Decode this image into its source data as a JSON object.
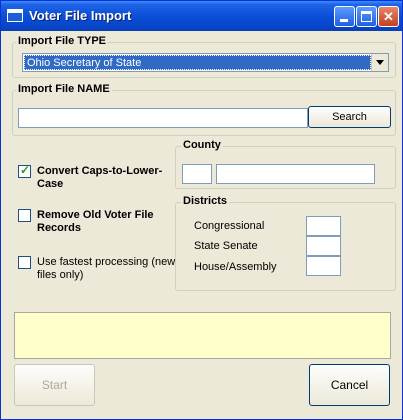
{
  "window": {
    "title": "Voter File Import"
  },
  "import_type": {
    "group_label": "Import File TYPE",
    "selected": "Ohio Secretary of State"
  },
  "import_name": {
    "group_label": "Import File NAME",
    "value": "",
    "search_label": "Search"
  },
  "options": {
    "convert_case": {
      "label": "Convert Caps-to-Lower-Case",
      "checked": true
    },
    "remove_old": {
      "label": "Remove Old Voter File Records",
      "checked": false
    },
    "fastest": {
      "label": "Use fastest processing (new files only)",
      "checked": false
    }
  },
  "county": {
    "group_label": "County",
    "code": "",
    "name": ""
  },
  "districts": {
    "group_label": "Districts",
    "congressional_label": "Congressional",
    "state_senate_label": "State Senate",
    "house_label": "House/Assembly",
    "congressional": "",
    "state_senate": "",
    "house": ""
  },
  "status": {
    "text": ""
  },
  "buttons": {
    "start": "Start",
    "cancel": "Cancel"
  },
  "colors": {
    "titlebar": "#0a4fd8",
    "selection": "#316ac5",
    "status_bg": "#ffffcc",
    "face": "#ece9d8"
  }
}
